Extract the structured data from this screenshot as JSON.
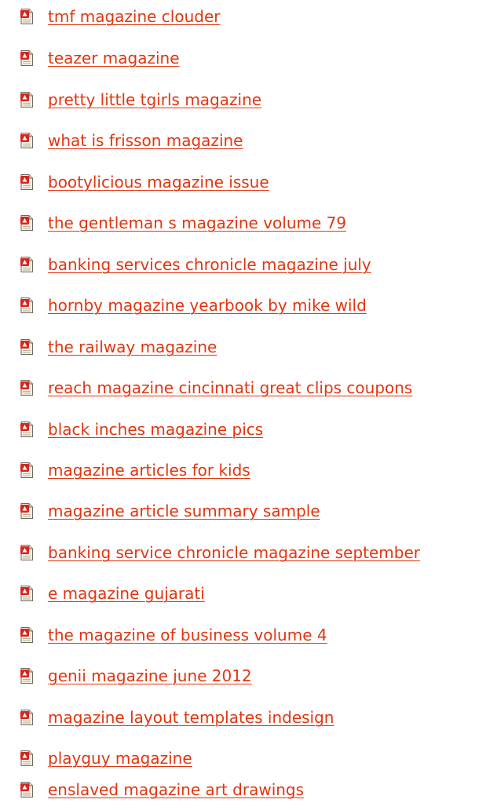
{
  "links": [
    "tmf magazine clouder",
    "teazer magazine",
    "pretty little tgirls magazine",
    "what is frisson magazine",
    "bootylicious magazine issue",
    "the gentleman s magazine volume 79",
    "banking services chronicle magazine july",
    "hornby magazine yearbook by mike wild",
    "the railway magazine",
    "reach magazine cincinnati great clips coupons",
    "black inches magazine pics",
    "magazine articles for kids",
    "magazine article summary sample",
    "banking service chronicle magazine september",
    "e magazine gujarati",
    "the magazine of business volume 4",
    "genii magazine june 2012",
    "magazine layout templates indesign",
    "playguy magazine",
    "enslaved magazine art drawings"
  ],
  "icon": "pdf-document-icon",
  "colors": {
    "link": "#e2350f",
    "icon_red": "#d7261c",
    "icon_paper": "#f3efe2"
  }
}
